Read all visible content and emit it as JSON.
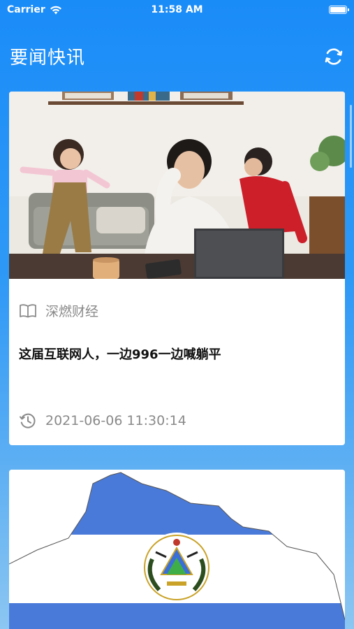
{
  "status_bar": {
    "carrier": "Carrier",
    "time": "11:58 AM"
  },
  "nav": {
    "title": "要闻快讯",
    "refresh_icon": "refresh-icon"
  },
  "articles": [
    {
      "source": "深燃财经",
      "title": "这届互联网人，一边996一边喊躺平",
      "time": "2021-06-06 11:30:14",
      "image": "photo-woman-laptop-kids"
    },
    {
      "image": "el-salvador-map-flag"
    }
  ],
  "colors": {
    "header_blue": "#1a8cf8",
    "card_bg": "#ffffff",
    "meta_gray": "#8a8a8a"
  }
}
